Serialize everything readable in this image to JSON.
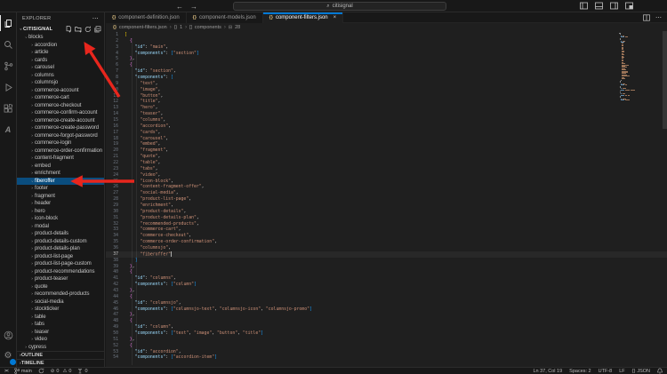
{
  "colors": {
    "accent": "#0078d4",
    "selection_blue": "#0a4d7e",
    "annotation_red": "#e8261d",
    "json_key": "#9cdcfe",
    "json_string": "#ce9178",
    "bracket_levels": [
      "#ffd700",
      "#da70d6",
      "#179fff"
    ]
  },
  "title_bar": {
    "back": "←",
    "forward": "→",
    "search_icon": "⌕",
    "search_value": "citisignal"
  },
  "explorer": {
    "title": "EXPLORER",
    "more": "⋯",
    "root": "CITISIGNAL",
    "folders_level1": [
      "blocks",
      "cypress"
    ],
    "blocks_label": "blocks",
    "cypress_label": "cypress",
    "items": [
      "accordion",
      "article",
      "cards",
      "carousel",
      "columns",
      "columnsjo",
      "commerce-account",
      "commerce-cart",
      "commerce-checkout",
      "commerce-confirm-account",
      "commerce-create-account",
      "commerce-create-password",
      "commerce-forgot-password",
      "commerce-login",
      "commerce-order-confirmation",
      "content-fragment",
      "embed",
      "enrichment",
      "fiberoffer",
      "footer",
      "fragment",
      "header",
      "hero",
      "icon-block",
      "modal",
      "product-details",
      "product-details-custom",
      "product-details-plan",
      "product-list-page",
      "product-list-page-custom",
      "product-recommendations",
      "product-teaser",
      "quote",
      "recommended-products",
      "social-media",
      "stockticker",
      "table",
      "tabs",
      "teaser",
      "video"
    ],
    "selected_item": "fiberoffer",
    "outline": "OUTLINE",
    "timeline": "TIMELINE"
  },
  "tabs": {
    "items": [
      {
        "label": "component-definition.json",
        "active": false
      },
      {
        "label": "component-models.json",
        "active": false
      },
      {
        "label": "component-filters.json",
        "active": true
      }
    ],
    "close_glyph": "×",
    "more_glyph": "⋯"
  },
  "breadcrumb": {
    "file": "component-filters.json",
    "segments": [
      "1",
      "components",
      "28"
    ],
    "separator": "›"
  },
  "editor": {
    "active_line": 37,
    "lines": [
      "[",
      "  {",
      "    \"id\": \"main\",",
      "    \"components\": [\"section\"]",
      "  },",
      "  {",
      "    \"id\": \"section\",",
      "    \"components\": [",
      "      \"text\",",
      "      \"image\",",
      "      \"button\",",
      "      \"title\",",
      "      \"hero\",",
      "      \"teaser\",",
      "      \"columns\",",
      "      \"accordion\",",
      "      \"cards\",",
      "      \"carousel\",",
      "      \"embed\",",
      "      \"fragment\",",
      "      \"quote\",",
      "      \"table\",",
      "      \"tabs\",",
      "      \"video\",",
      "      \"icon-block\",",
      "      \"content-fragment-offer\",",
      "      \"social-media\",",
      "      \"product-list-page\",",
      "      \"enrichment\",",
      "      \"product-details\",",
      "      \"product-details-plan\",",
      "      \"recommended-products\",",
      "      \"commerce-cart\",",
      "      \"commerce-checkout\",",
      "      \"commerce-order-confirmation\",",
      "      \"columnsjo\",",
      "      \"fiberoffer\"",
      "    ]",
      "  },",
      "  {",
      "    \"id\": \"columns\",",
      "    \"components\": [\"column\"]",
      "  },",
      "  {",
      "    \"id\": \"columnsjo\",",
      "    \"components\": [\"columnsjo-text\", \"columnsjo-icon\", \"columnsjo-promo\"]",
      "  },",
      "  {",
      "    \"id\": \"column\",",
      "    \"components\": [\"text\", \"image\", \"button\", \"title\"]",
      "  },",
      "  {",
      "    \"id\": \"accordion\",",
      "    \"components\": [\"accordion-item\"]"
    ]
  },
  "status_bar": {
    "remote": "><",
    "branch": "main",
    "errors": "0",
    "warnings": "0",
    "ports": "0",
    "ln_col": "Ln 37, Col 19",
    "spaces": "Spaces: 2",
    "encoding": "UTF-8",
    "eol": "LF",
    "language": "JSON",
    "lang_icon": "{}"
  }
}
